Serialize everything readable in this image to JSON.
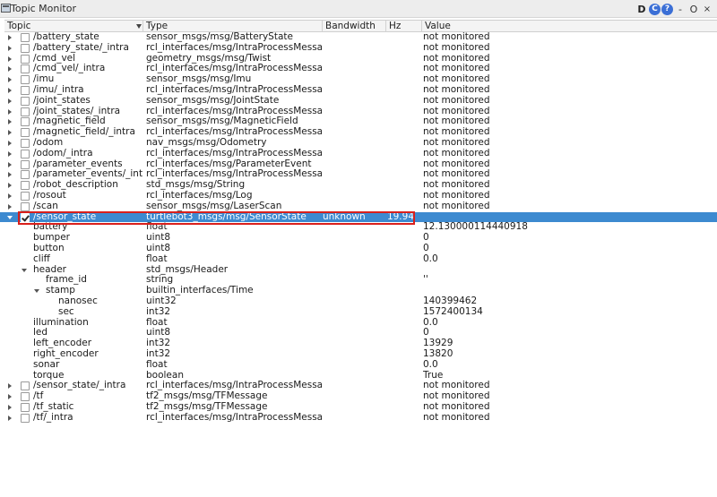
{
  "window": {
    "title": "Topic Monitor",
    "buttons": [
      "D",
      "C",
      "?",
      "-",
      "O",
      "×"
    ]
  },
  "columns": [
    "Topic",
    "Type",
    "Bandwidth",
    "Hz",
    "Value"
  ],
  "topics_before": [
    {
      "topic": "/battery_state",
      "type": "sensor_msgs/msg/BatteryState",
      "value": "not monitored"
    },
    {
      "topic": "/battery_state/_intra",
      "type": "rcl_interfaces/msg/IntraProcessMessage",
      "value": "not monitored"
    },
    {
      "topic": "/cmd_vel",
      "type": "geometry_msgs/msg/Twist",
      "value": "not monitored"
    },
    {
      "topic": "/cmd_vel/_intra",
      "type": "rcl_interfaces/msg/IntraProcessMessage",
      "value": "not monitored"
    },
    {
      "topic": "/imu",
      "type": "sensor_msgs/msg/Imu",
      "value": "not monitored"
    },
    {
      "topic": "/imu/_intra",
      "type": "rcl_interfaces/msg/IntraProcessMessage",
      "value": "not monitored"
    },
    {
      "topic": "/joint_states",
      "type": "sensor_msgs/msg/JointState",
      "value": "not monitored"
    },
    {
      "topic": "/joint_states/_intra",
      "type": "rcl_interfaces/msg/IntraProcessMessage",
      "value": "not monitored"
    },
    {
      "topic": "/magnetic_field",
      "type": "sensor_msgs/msg/MagneticField",
      "value": "not monitored"
    },
    {
      "topic": "/magnetic_field/_intra",
      "type": "rcl_interfaces/msg/IntraProcessMessage",
      "value": "not monitored"
    },
    {
      "topic": "/odom",
      "type": "nav_msgs/msg/Odometry",
      "value": "not monitored"
    },
    {
      "topic": "/odom/_intra",
      "type": "rcl_interfaces/msg/IntraProcessMessage",
      "value": "not monitored"
    },
    {
      "topic": "/parameter_events",
      "type": "rcl_interfaces/msg/ParameterEvent",
      "value": "not monitored"
    },
    {
      "topic": "/parameter_events/_intra",
      "type": "rcl_interfaces/msg/IntraProcessMessage",
      "value": "not monitored"
    },
    {
      "topic": "/robot_description",
      "type": "std_msgs/msg/String",
      "value": "not monitored"
    },
    {
      "topic": "/rosout",
      "type": "rcl_interfaces/msg/Log",
      "value": "not monitored"
    },
    {
      "topic": "/scan",
      "type": "sensor_msgs/msg/LaserScan",
      "value": "not monitored"
    }
  ],
  "selected_topic": {
    "topic": "/sensor_state",
    "type": "turtlebot3_msgs/msg/SensorState",
    "bandwidth": "unknown",
    "hz": "19.94",
    "value": "",
    "checked": true
  },
  "fields": [
    {
      "name": "battery",
      "type": "float",
      "value": "12.130000114440918"
    },
    {
      "name": "bumper",
      "type": "uint8",
      "value": "0"
    },
    {
      "name": "button",
      "type": "uint8",
      "value": "0"
    },
    {
      "name": "cliff",
      "type": "float",
      "value": "0.0"
    },
    {
      "name": "header",
      "type": "std_msgs/Header",
      "value": ""
    },
    {
      "name": "frame_id",
      "type": "string",
      "value": "''"
    },
    {
      "name": "stamp",
      "type": "builtin_interfaces/Time",
      "value": ""
    },
    {
      "name": "nanosec",
      "type": "uint32",
      "value": "140399462"
    },
    {
      "name": "sec",
      "type": "int32",
      "value": "1572400134"
    },
    {
      "name": "illumination",
      "type": "float",
      "value": "0.0"
    },
    {
      "name": "led",
      "type": "uint8",
      "value": "0"
    },
    {
      "name": "left_encoder",
      "type": "int32",
      "value": "13929"
    },
    {
      "name": "right_encoder",
      "type": "int32",
      "value": "13820"
    },
    {
      "name": "sonar",
      "type": "float",
      "value": "0.0"
    },
    {
      "name": "torque",
      "type": "boolean",
      "value": "True"
    }
  ],
  "topics_after": [
    {
      "topic": "/sensor_state/_intra",
      "type": "rcl_interfaces/msg/IntraProcessMessage",
      "value": "not monitored"
    },
    {
      "topic": "/tf",
      "type": "tf2_msgs/msg/TFMessage",
      "value": "not monitored"
    },
    {
      "topic": "/tf_static",
      "type": "tf2_msgs/msg/TFMessage",
      "value": "not monitored"
    },
    {
      "topic": "/tf/_intra",
      "type": "rcl_interfaces/msg/IntraProcessMessage",
      "value": "not monitored"
    }
  ]
}
